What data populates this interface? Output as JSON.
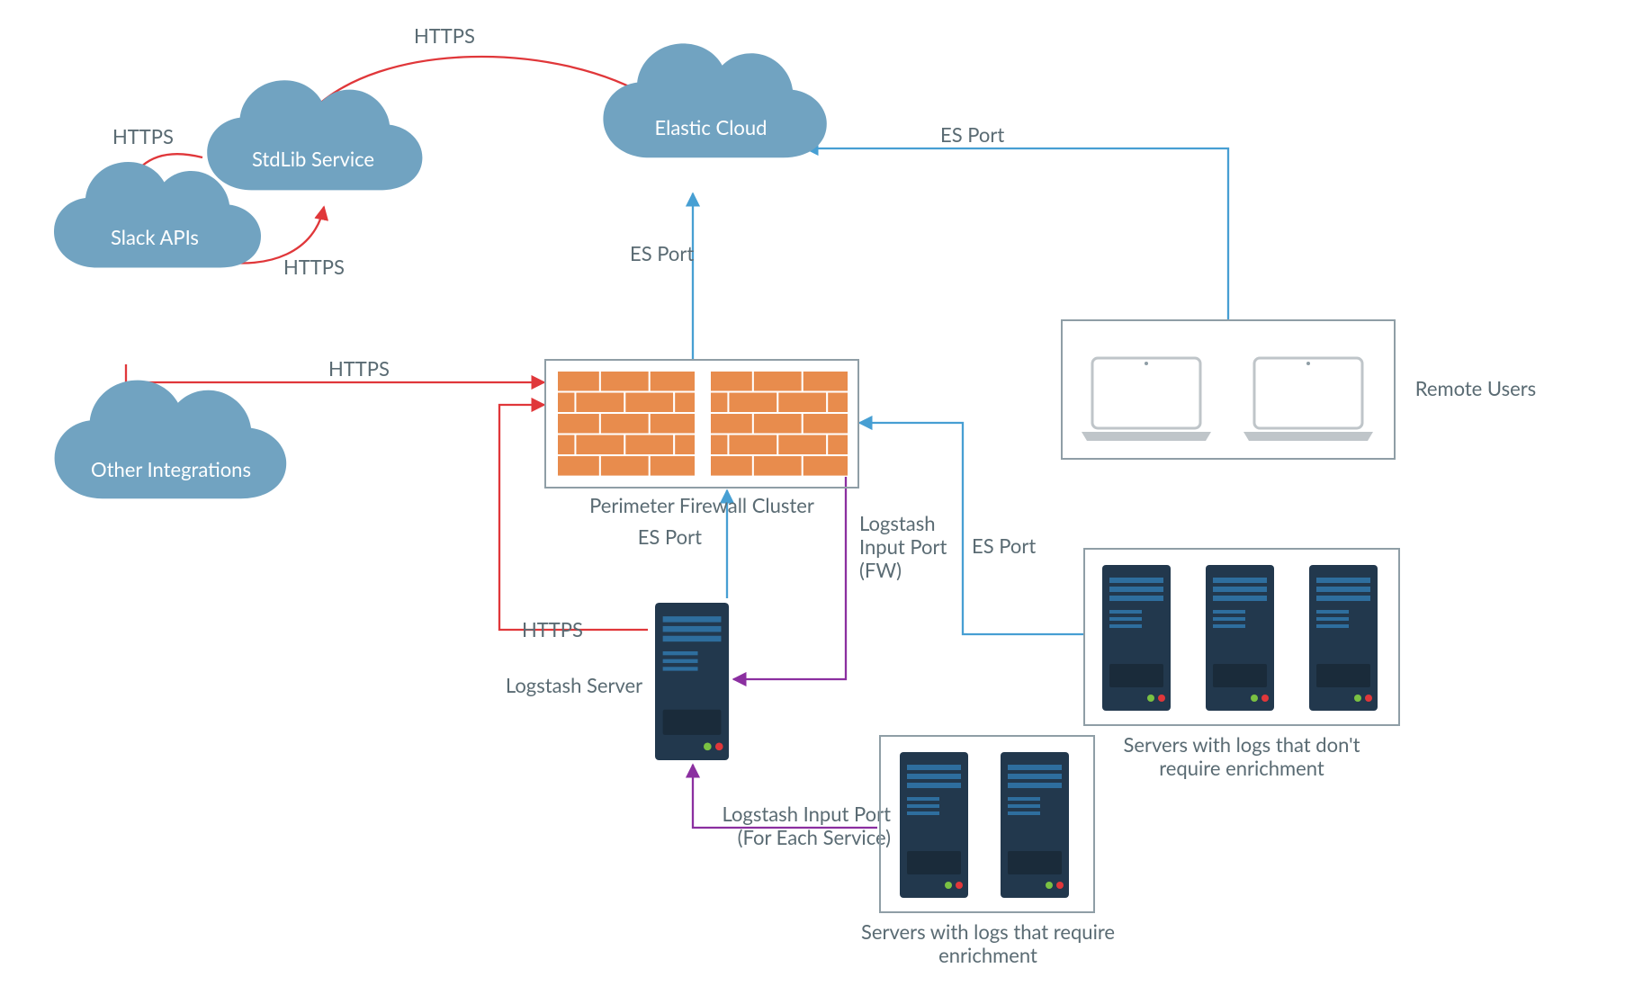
{
  "clouds": {
    "elastic": {
      "label": "Elastic Cloud"
    },
    "stdlib": {
      "label": "StdLib Service"
    },
    "slack": {
      "label": "Slack APIs"
    },
    "other": {
      "label": "Other Integrations"
    }
  },
  "nodes": {
    "firewall": {
      "label": "Perimeter Firewall Cluster"
    },
    "logstash": {
      "label": "Logstash Server"
    },
    "remote_users": {
      "label": "Remote Users"
    },
    "enrich_servers": {
      "label": "Servers with logs that require\nenrichment"
    },
    "noenrich_servers": {
      "label": "Servers with logs that don't\nrequire enrichment"
    }
  },
  "edges": {
    "stdlib_to_elastic": {
      "label": "HTTPS"
    },
    "slack_to_stdlib": {
      "label": "HTTPS"
    },
    "stdlib_to_slack": {
      "label": "HTTPS"
    },
    "other_to_firewall": {
      "label": "HTTPS"
    },
    "logstash_to_firewall": {
      "label": "HTTPS"
    },
    "firewall_to_elastic": {
      "label": "ES Port"
    },
    "logstash_to_fw_es": {
      "label": "ES Port"
    },
    "logstash_to_fw_in": {
      "label": "Logstash\nInput Port\n(FW)"
    },
    "remote_to_elastic": {
      "label": "ES Port"
    },
    "noenrich_to_fw": {
      "label": "ES Port"
    },
    "enrich_to_logstash": {
      "label": "Logstash Input Port\n(For Each Service)"
    }
  },
  "colors": {
    "cloud": "#71a3c1",
    "red": "#e0373a",
    "blue": "#479fd3",
    "purple": "#8b2fa0",
    "brick": "#e88c4d",
    "server": "#22384d"
  }
}
